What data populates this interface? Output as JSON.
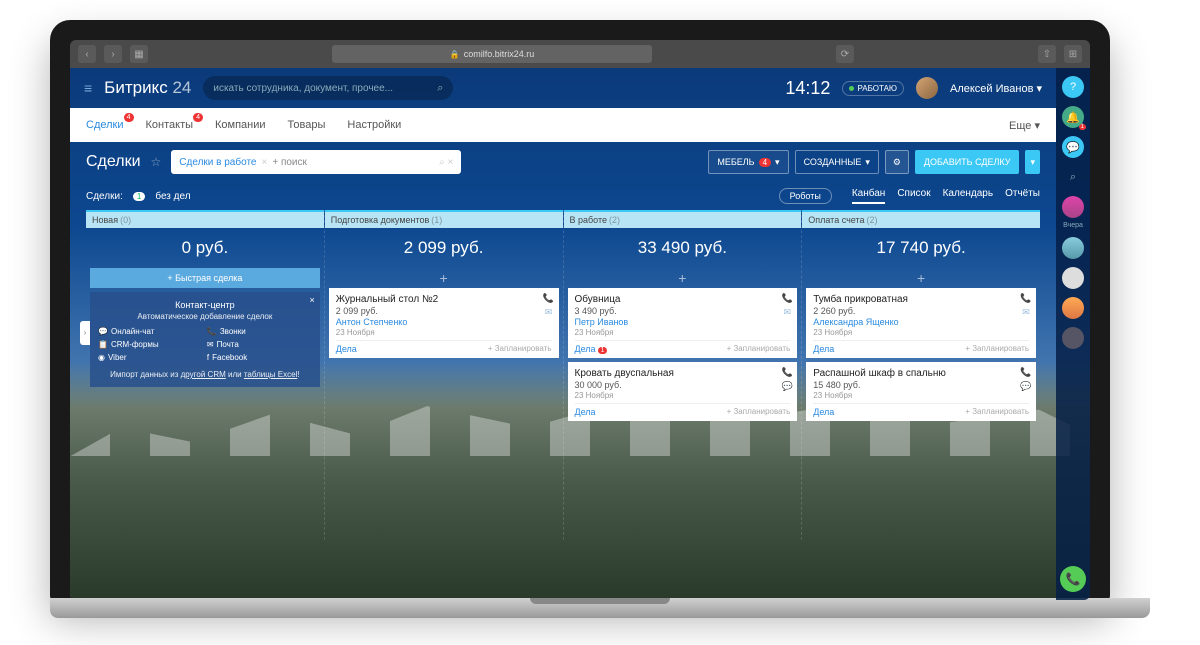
{
  "browser": {
    "url": "comilfo.bitrix24.ru"
  },
  "app": {
    "logo_main": "Битрикс",
    "logo_num": "24",
    "search_placeholder": "искать сотрудника, документ, прочее...",
    "time": "14:12",
    "status": "РАБОТАЮ",
    "user": "Алексей Иванов"
  },
  "tabs": [
    "Сделки",
    "Контакты",
    "Компании",
    "Товары",
    "Настройки"
  ],
  "tabs_more": "Еще",
  "tab_badges": {
    "0": "4",
    "1": "4"
  },
  "page": {
    "title": "Сделки",
    "filter_tag": "Сделки в работе",
    "filter_placeholder": "+ поиск",
    "furniture": "МЕБЕЛЬ",
    "furniture_count": "4",
    "created": "СОЗДАННЫЕ",
    "add": "ДОБАВИТЬ СДЕЛКУ"
  },
  "subheader": {
    "deals": "Сделки:",
    "count": "1",
    "nodeal": "без дел",
    "robots": "Роботы",
    "views": [
      "Канбан",
      "Список",
      "Календарь",
      "Отчёты"
    ]
  },
  "columns": [
    {
      "name": "Новая",
      "count": "(0)",
      "sum": "0 руб.",
      "quick": "+ Быстрая сделка"
    },
    {
      "name": "Подготовка документов",
      "count": "(1)",
      "sum": "2 099 руб."
    },
    {
      "name": "В работе",
      "count": "(2)",
      "sum": "33 490 руб."
    },
    {
      "name": "Оплата счета",
      "count": "(2)",
      "sum": "17 740 руб."
    }
  ],
  "contact_panel": {
    "title": "Контакт-центр",
    "sub": "Автоматическое добавление сделок",
    "items": [
      "Онлайн-чат",
      "Звонки",
      "CRM-формы",
      "Почта",
      "Viber",
      "Facebook"
    ],
    "import": "Импорт данных из ",
    "l1": "другой CRM",
    "mid": " или ",
    "l2": "таблицы Excel"
  },
  "cards": {
    "c1": [
      {
        "title": "Журнальный стол №2",
        "price": "2 099 руб.",
        "contact": "Антон Степченко",
        "date": "23 Ноября",
        "dela": "Дела",
        "plan": "+ Запланировать"
      }
    ],
    "c2": [
      {
        "title": "Обувница",
        "price": "3 490 руб.",
        "contact": "Петр Иванов",
        "date": "23 Ноября",
        "dela": "Дела",
        "dela_badge": "1",
        "plan": "+ Запланировать"
      },
      {
        "title": "Кровать двуспальная",
        "price": "30 000 руб.",
        "contact": "",
        "date": "23 Ноября",
        "dela": "Дела",
        "plan": "+ Запланировать"
      }
    ],
    "c3": [
      {
        "title": "Тумба прикроватная",
        "price": "2 260 руб.",
        "contact": "Александра Ященко",
        "date": "23 Ноября",
        "dela": "Дела",
        "plan": "+ Запланировать"
      },
      {
        "title": "Распашной шкаф в спальню",
        "price": "15 480 руб.",
        "contact": "",
        "date": "23 Ноября",
        "dela": "Дела",
        "plan": "+ Запланировать"
      }
    ]
  },
  "sidebar_label": "Вчера"
}
